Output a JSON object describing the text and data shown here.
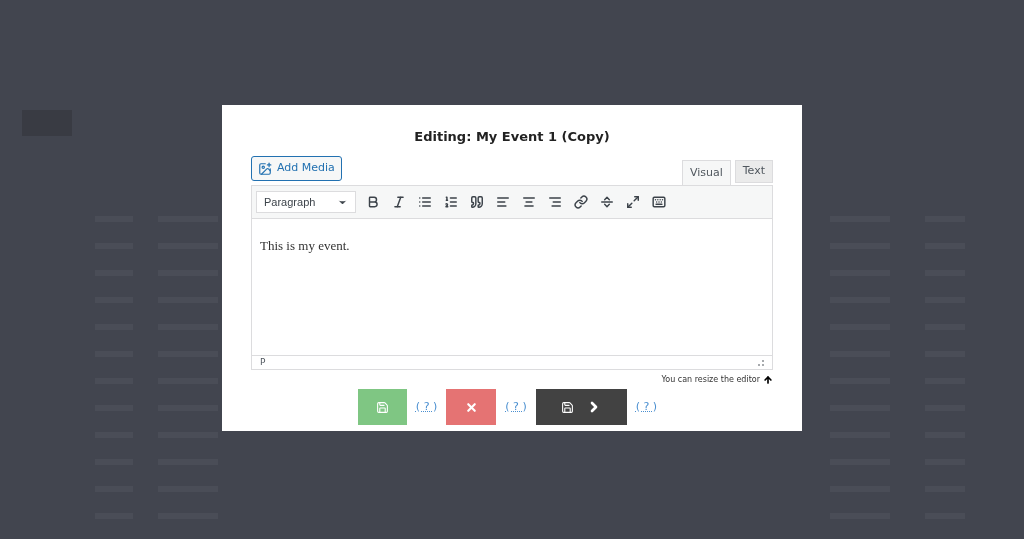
{
  "dialog": {
    "title": "Editing: My Event 1 (Copy)",
    "add_media": "Add Media",
    "tabs": [
      {
        "label": "Visual",
        "selected": true
      },
      {
        "label": "Text",
        "selected": false
      }
    ],
    "format_select": "Paragraph",
    "content": "This is my event.",
    "path": "P",
    "resize_note": "You can resize the editor",
    "actions": [
      {
        "kind": "save",
        "help": "( ? )"
      },
      {
        "kind": "cancel",
        "help": "( ? )"
      },
      {
        "kind": "save-next",
        "help": "( ? )"
      }
    ]
  }
}
